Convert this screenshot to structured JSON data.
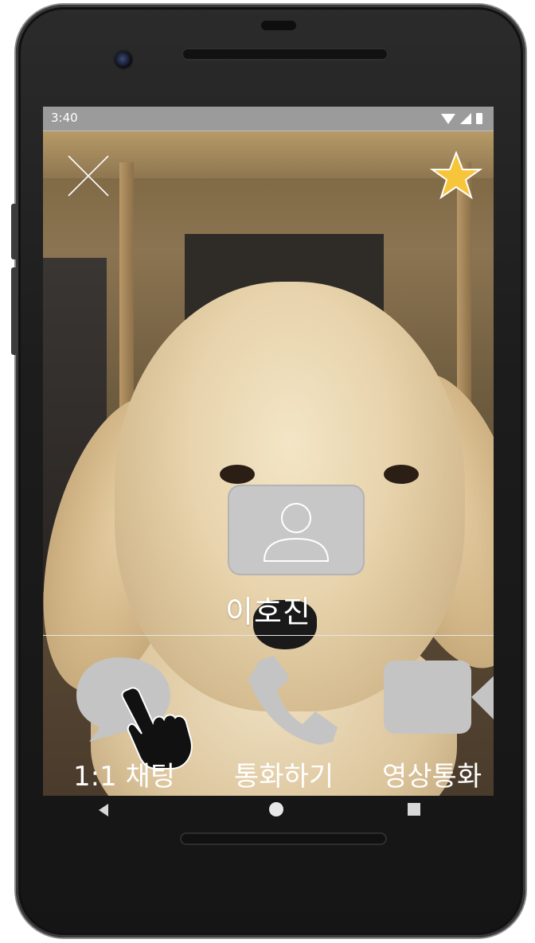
{
  "statusbar": {
    "time": "3:40"
  },
  "contact": {
    "name": "이호진"
  },
  "actions": [
    {
      "label": "1:1 채팅",
      "icon": "chat-bubble-icon"
    },
    {
      "label": "통화하기",
      "icon": "phone-icon"
    },
    {
      "label": "영상통화",
      "icon": "video-camera-icon"
    }
  ],
  "colors": {
    "star": "#f7c53a",
    "icon_gray": "#c4c4c4",
    "status_bar": "#9b9b9b"
  }
}
